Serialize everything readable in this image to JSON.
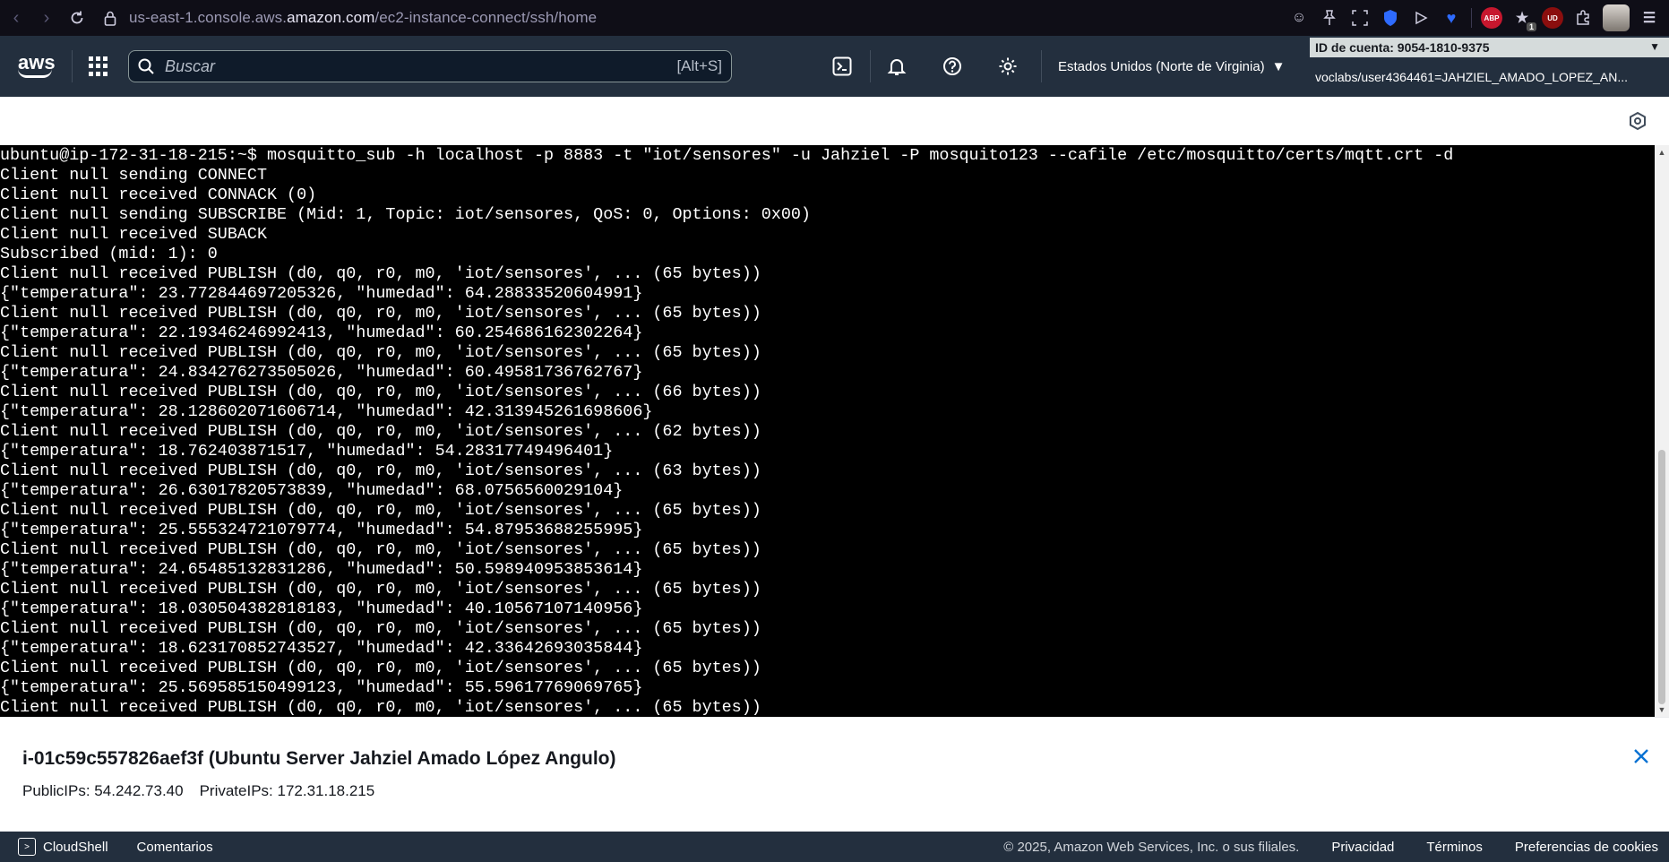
{
  "browser": {
    "url_prefix": "us-east-1.console.aws.",
    "url_host": "amazon.com",
    "url_path": "/ec2-instance-connect/ssh/home",
    "ext_abp": "ABP",
    "ext_ud": "UD",
    "ext_badge_count": "1"
  },
  "header": {
    "logo_text": "aws",
    "search_placeholder": "Buscar",
    "search_shortcut": "[Alt+S]",
    "region": "Estados Unidos (Norte de Virginia)",
    "account_id": "ID de cuenta: 9054-1810-9375",
    "account_user": "voclabs/user4364461=JAHZIEL_AMADO_LOPEZ_AN..."
  },
  "terminal": {
    "lines": [
      "ubuntu@ip-172-31-18-215:~$ mosquitto_sub -h localhost -p 8883 -t \"iot/sensores\" -u Jahziel -P mosquito123 --cafile /etc/mosquitto/certs/mqtt.crt -d",
      "Client null sending CONNECT",
      "Client null received CONNACK (0)",
      "Client null sending SUBSCRIBE (Mid: 1, Topic: iot/sensores, QoS: 0, Options: 0x00)",
      "Client null received SUBACK",
      "Subscribed (mid: 1): 0",
      "Client null received PUBLISH (d0, q0, r0, m0, 'iot/sensores', ... (65 bytes))",
      "{\"temperatura\": 23.772844697205326, \"humedad\": 64.28833520604991}",
      "Client null received PUBLISH (d0, q0, r0, m0, 'iot/sensores', ... (65 bytes))",
      "{\"temperatura\": 22.19346246992413, \"humedad\": 60.254686162302264}",
      "Client null received PUBLISH (d0, q0, r0, m0, 'iot/sensores', ... (65 bytes))",
      "{\"temperatura\": 24.834276273505026, \"humedad\": 60.49581736762767}",
      "Client null received PUBLISH (d0, q0, r0, m0, 'iot/sensores', ... (66 bytes))",
      "{\"temperatura\": 28.128602071606714, \"humedad\": 42.313945261698606}",
      "Client null received PUBLISH (d0, q0, r0, m0, 'iot/sensores', ... (62 bytes))",
      "{\"temperatura\": 18.762403871517, \"humedad\": 54.28317749496401}",
      "Client null received PUBLISH (d0, q0, r0, m0, 'iot/sensores', ... (63 bytes))",
      "{\"temperatura\": 26.63017820573839, \"humedad\": 68.0756560029104}",
      "Client null received PUBLISH (d0, q0, r0, m0, 'iot/sensores', ... (65 bytes))",
      "{\"temperatura\": 25.555324721079774, \"humedad\": 54.87953688255995}",
      "Client null received PUBLISH (d0, q0, r0, m0, 'iot/sensores', ... (65 bytes))",
      "{\"temperatura\": 24.65485132831286, \"humedad\": 50.598940953853614}",
      "Client null received PUBLISH (d0, q0, r0, m0, 'iot/sensores', ... (65 bytes))",
      "{\"temperatura\": 18.030504382818183, \"humedad\": 40.10567107140956}",
      "Client null received PUBLISH (d0, q0, r0, m0, 'iot/sensores', ... (65 bytes))",
      "{\"temperatura\": 18.623170852743527, \"humedad\": 42.33642693035844}",
      "Client null received PUBLISH (d0, q0, r0, m0, 'iot/sensores', ... (65 bytes))",
      "{\"temperatura\": 25.569585150499123, \"humedad\": 55.59617769069765}",
      "Client null received PUBLISH (d0, q0, r0, m0, 'iot/sensores', ... (65 bytes))"
    ]
  },
  "instance": {
    "title": "i-01c59c557826aef3f (Ubuntu Server Jahziel Amado López Angulo)",
    "public_ips": "PublicIPs: 54.242.73.40",
    "private_ips": "PrivateIPs: 172.31.18.215"
  },
  "footer": {
    "cloudshell": "CloudShell",
    "comentarios": "Comentarios",
    "copyright": "© 2025, Amazon Web Services, Inc. o sus filiales.",
    "privacidad": "Privacidad",
    "terminos": "Términos",
    "cookies": "Preferencias de cookies"
  }
}
